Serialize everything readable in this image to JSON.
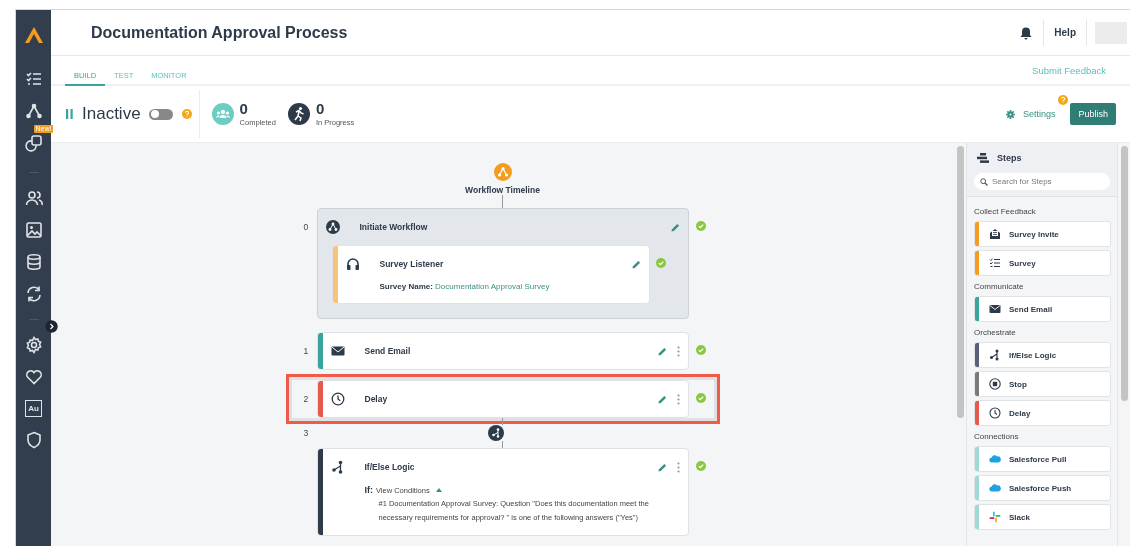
{
  "sidebar": {
    "new_badge": "New!",
    "boxed_label": "Au"
  },
  "header": {
    "title": "Documentation Approval Process",
    "help": "Help"
  },
  "tabs": [
    {
      "label": "BUILD",
      "selected": true
    },
    {
      "label": "TEST",
      "selected": false
    },
    {
      "label": "MONITOR",
      "selected": false
    }
  ],
  "submit_feedback": "Submit Feedback",
  "status_bar": {
    "state": "Inactive",
    "on": false,
    "stats": [
      {
        "kind": "completed",
        "value": "0",
        "label": "Completed"
      },
      {
        "kind": "in_progress",
        "value": "0",
        "label": "In Progress"
      }
    ],
    "settings": "Settings",
    "publish": "Publish"
  },
  "timeline": {
    "title": "Workflow Timeline",
    "steps": [
      {
        "number": "0",
        "kind": "trigger",
        "title": "Initiate Workflow",
        "valid": true,
        "highlighted": false,
        "children": [
          {
            "kind": "listener",
            "title": "Survey Listener",
            "color": "#f7c37a",
            "valid": true,
            "detail_label": "Survey Name:",
            "detail_value": "Documentation Approval Survey"
          }
        ]
      },
      {
        "number": "1",
        "kind": "email",
        "title": "Send Email",
        "color": "#3aa39b",
        "valid": true,
        "highlighted": false
      },
      {
        "number": "2",
        "kind": "delay",
        "title": "Delay",
        "color": "#e45b4d",
        "valid": true,
        "highlighted": true
      },
      {
        "number": "3",
        "kind": "logic",
        "title": "If/Else Logic",
        "color": "#2f3b4b",
        "valid": true,
        "highlighted": false,
        "condition": {
          "label": "If:",
          "toggle": "View Conditions",
          "expanded": true,
          "text": "#1 Documentation Approval Survey: Question \"Does this documentation meet the necessary requirements for approval? \" is one of the following answers (\"Yes\")"
        }
      }
    ]
  },
  "steps_panel": {
    "title": "Steps",
    "search": {
      "placeholder": "Search for Steps"
    },
    "groups": [
      {
        "label": "Collect Feedback",
        "items": [
          {
            "kind": "survey_invite",
            "label": "Survey Invite",
            "color": "#f39c1f"
          },
          {
            "kind": "survey",
            "label": "Survey",
            "color": "#f39c1f"
          }
        ]
      },
      {
        "label": "Communicate",
        "items": [
          {
            "kind": "email",
            "label": "Send Email",
            "color": "#3aa39b"
          }
        ]
      },
      {
        "label": "Orchestrate",
        "items": [
          {
            "kind": "logic",
            "label": "If/Else Logic",
            "color": "#5b6079"
          },
          {
            "kind": "stop",
            "label": "Stop",
            "color": "#7a7a7a"
          },
          {
            "kind": "delay",
            "label": "Delay",
            "color": "#e45b4d"
          }
        ]
      },
      {
        "label": "Connections",
        "items": [
          {
            "kind": "cloud",
            "label": "Salesforce Pull",
            "color": "#9fd9d3"
          },
          {
            "kind": "cloud",
            "label": "Salesforce Push",
            "color": "#9fd9d3"
          },
          {
            "kind": "slack",
            "label": "Slack",
            "color": "#9fd9d3"
          }
        ]
      }
    ]
  }
}
